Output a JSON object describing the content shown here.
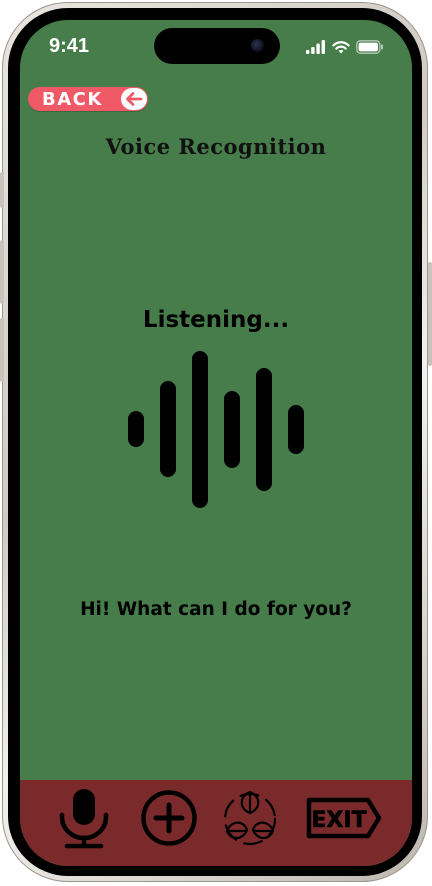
{
  "status_bar": {
    "time": "9:41"
  },
  "back_button": {
    "label": "BACK"
  },
  "page": {
    "title": "Voice Recognition",
    "listening_text": "Listening...",
    "prompt": "Hi! What can I do for you?"
  },
  "bottom_nav": {
    "items": [
      {
        "icon": "microphone-icon"
      },
      {
        "icon": "plus-circle-icon"
      },
      {
        "icon": "recycle-leaves-icon"
      },
      {
        "icon": "exit-sign-icon",
        "label": "EXIT"
      }
    ]
  },
  "colors": {
    "screen_background": "#467d4b",
    "bottom_nav_background": "#7a2a2b",
    "back_button": "#ef5a66"
  }
}
